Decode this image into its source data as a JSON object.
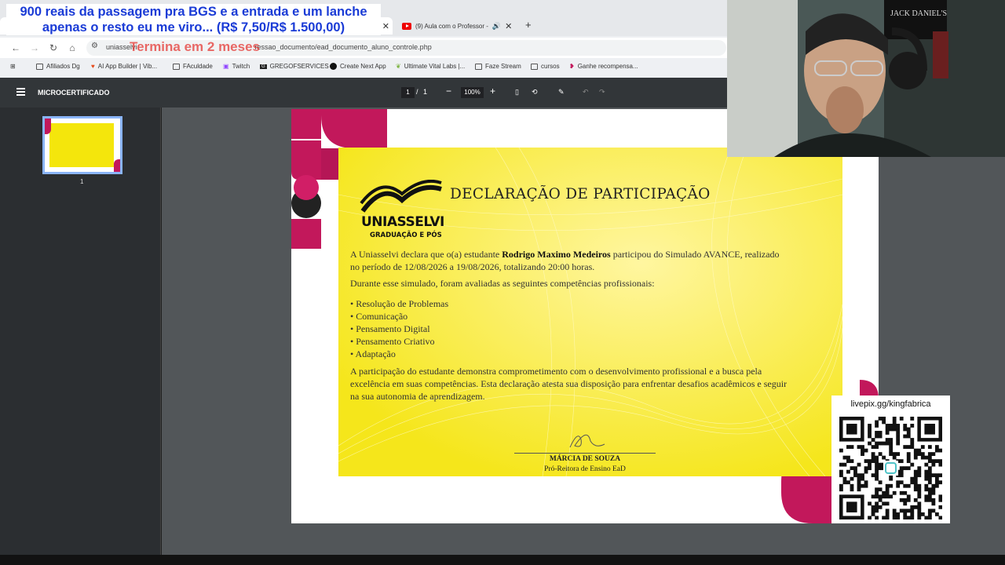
{
  "overlay": {
    "banner_line1": "900 reais da passagem pra BGS e a entrada e um lanche",
    "banner_line2": "apenas o resto eu me viro... (R$ 7,50/R$ 1.500,00)",
    "countdown": "Termina em 2 meses"
  },
  "browser": {
    "tabs": [
      {
        "label": "",
        "active": true
      },
      {
        "label": "(9) Aula com o Professor -",
        "active": false
      }
    ],
    "url": "uniasselvi.com.br/.../impressao_documento/ead_documento_aluno_controle.php",
    "url_prefix": "uniasselvi",
    "url_suffix": "ressao_documento/ead_documento_aluno_controle.php",
    "bookmarks": [
      {
        "label": "Afiliados Dg",
        "icon": "folder-icon"
      },
      {
        "label": "AI App Builder | Vib...",
        "icon": "heart-icon"
      },
      {
        "label": "FAculdade",
        "icon": "folder-icon"
      },
      {
        "label": "Twitch",
        "icon": "twitch-icon"
      },
      {
        "label": "GREGOFSERVICES",
        "icon": "app-icon"
      },
      {
        "label": "Create Next App",
        "icon": "app-icon"
      },
      {
        "label": "Ultimate Vital Labs |...",
        "icon": "leaf-icon"
      },
      {
        "label": "Faze Stream",
        "icon": "folder-icon"
      },
      {
        "label": "cursos",
        "icon": "folder-icon"
      },
      {
        "label": "Ganhe recompensa...",
        "icon": "gift-icon"
      }
    ]
  },
  "pdf": {
    "title": "MICROCERTIFICADO",
    "page_current": "1",
    "page_sep": "/",
    "page_total": "1",
    "zoom": "100%",
    "thumb_label": "1"
  },
  "certificate": {
    "title": "DECLARAÇÃO DE PARTICIPAÇÃO",
    "logo_name": "UNIASSELVI",
    "logo_sub": "GRADUAÇÃO E PÓS",
    "para1_start": "A Uniasselvi declara que o(a) estudante ",
    "student": "Rodrigo Maximo Medeiros",
    "para1_end": " participou do Simulado AVANCE, realizado no período de 12/08/2026 a 19/08/2026, totalizando 20:00 horas.",
    "para2": "Durante esse simulado, foram avaliadas as seguintes competências profissionais:",
    "competencies": [
      "Resolução de Problemas",
      "Comunicação",
      "Pensamento Digital",
      "Pensamento Criativo",
      "Adaptação"
    ],
    "para3": "A participação do estudante demonstra comprometimento com o desenvolvimento profissional e a busca pela excelência em suas competências. Esta declaração atesta sua disposição para enfrentar desafios acadêmicos e seguir na sua autonomia de aprendizagem.",
    "signer": "MÁRCIA DE SOUZA",
    "signer_role": "Pró-Reitora de Ensino EaD"
  },
  "qr": {
    "label": "livepix.gg/kingfabrica"
  },
  "colors": {
    "cert_yellow": "#f5e61b",
    "petal_magenta": "#c2185b",
    "banner_blue": "#1a3bd6",
    "countdown_red": "#e53935",
    "pdf_toolbar": "#323639"
  }
}
